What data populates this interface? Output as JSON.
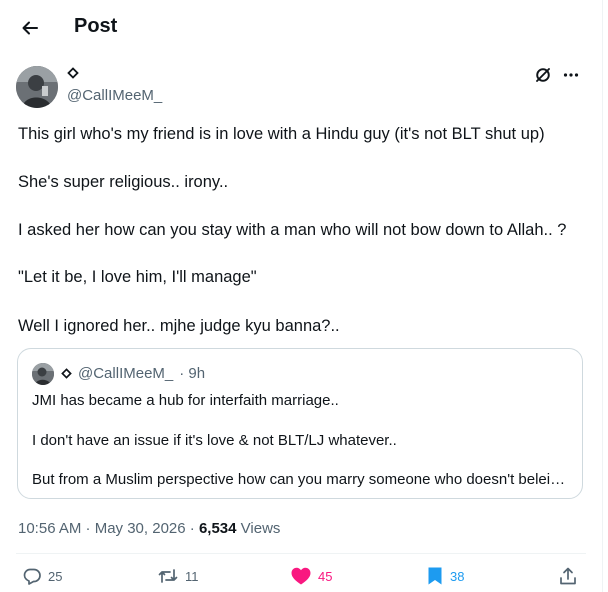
{
  "header": {
    "title": "Post"
  },
  "author": {
    "display_name": "◇",
    "handle": "@CallIMeeM_"
  },
  "tweet": {
    "lines": [
      "This girl who's my friend is in love with a Hindu guy (it's not BLT shut up)",
      "She's super religious.. irony..",
      "I asked her how can you stay with a man who will not bow down to Allah.. ?",
      "\"Let it be, I love him, I'll manage\"",
      "Well I ignored her.. mjhe judge kyu banna?.."
    ]
  },
  "quote": {
    "display_name": "◇",
    "handle": "@CallIMeeM_",
    "time": "· 9h",
    "lines": [
      "JMI has became a hub for interfaith marriage..",
      "I don't have an issue if it's love & not BLT/LJ whatever..",
      "But from a Muslim perspective how can you marry someone who doesn't beleive in Allah"
    ]
  },
  "meta": {
    "time": "10:56 AM · May 30, 2026 · ",
    "views_count": "6,534",
    "views_label": "Views"
  },
  "actions": {
    "replies": "25",
    "reposts": "11",
    "likes": "45",
    "bookmarks": "38"
  },
  "colors": {
    "like": "#f91880",
    "bookmark": "#1d9bf0",
    "secondary": "#536471"
  }
}
